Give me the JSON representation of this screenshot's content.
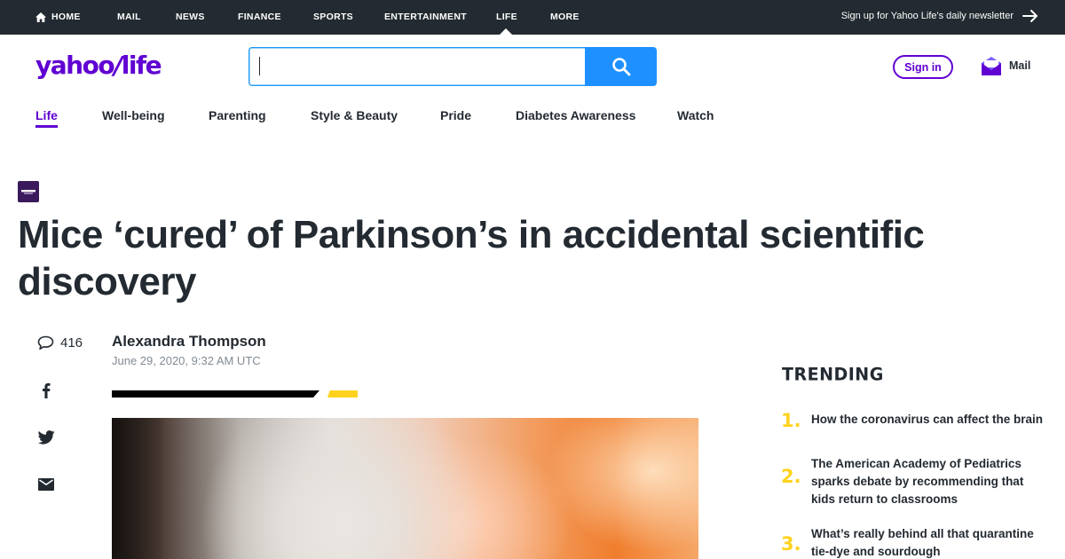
{
  "topnav": {
    "items": [
      "HOME",
      "MAIL",
      "NEWS",
      "FINANCE",
      "SPORTS",
      "ENTERTAINMENT",
      "LIFE",
      "MORE"
    ],
    "active": "LIFE",
    "newsletter": "Sign up for Yahoo Life's daily newsletter"
  },
  "header": {
    "logo_main": "yahoo",
    "logo_slash": "/",
    "logo_sub": "life",
    "search_value": "",
    "signin_label": "Sign in",
    "mail_label": "Mail"
  },
  "secnav": {
    "items": [
      "Life",
      "Well-being",
      "Parenting",
      "Style & Beauty",
      "Pride",
      "Diabetes Awareness",
      "Watch"
    ],
    "active": "Life"
  },
  "article": {
    "headline": "Mice ‘cured’ of Parkinson’s in accidental scientific discovery",
    "author": "Alexandra Thompson",
    "date": "June 29, 2020, 9:32 AM UTC",
    "comment_count": "416"
  },
  "share": {
    "icons": [
      "facebook-icon",
      "twitter-icon",
      "email-icon"
    ]
  },
  "trending": {
    "title": "TRENDING",
    "items": [
      {
        "num": "1.",
        "text": "How the coronavirus can affect the brain"
      },
      {
        "num": "2.",
        "text": "The American Academy of Pediatrics sparks debate by recommending that kids return to classrooms"
      },
      {
        "num": "3.",
        "text": "What’s really behind all that quarantine tie-dye and sourdough"
      }
    ]
  },
  "colors": {
    "brand": "#6001d2",
    "topbar": "#232a31",
    "search_button": "#1e90ff",
    "accent_yellow": "#ffd21f"
  }
}
